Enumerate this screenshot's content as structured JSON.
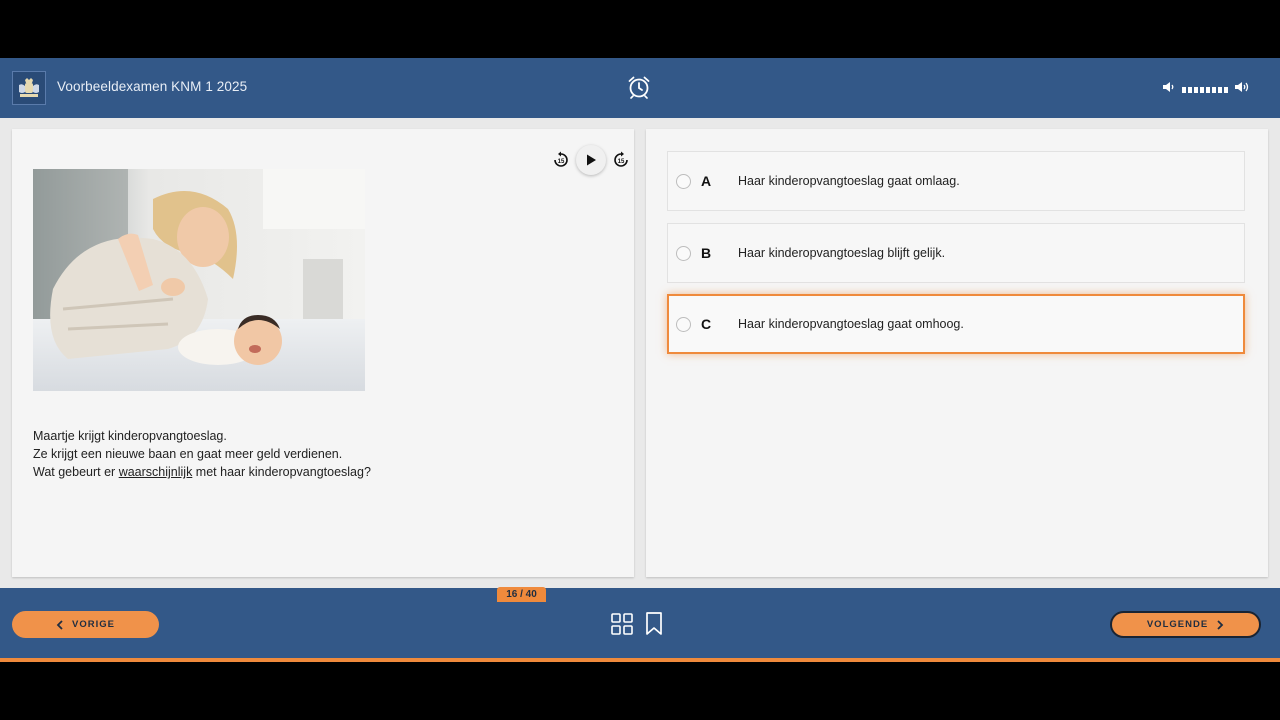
{
  "header": {
    "title": "Voorbeeldexamen KNM 1 2025",
    "logo_icon": "royal-coat-of-arms-icon",
    "timer_icon": "alarm-clock-icon",
    "volume": {
      "mute_icon": "volume-low-icon",
      "loud_icon": "volume-high-icon",
      "level_segments": 8
    }
  },
  "question_panel": {
    "audio": {
      "rewind_icon": "rewind-15-icon",
      "play_icon": "play-icon",
      "forward_icon": "forward-15-icon"
    },
    "image": "mother-playing-with-baby-photo",
    "lines": [
      "Maartje krijgt kinderopvangtoeslag.",
      "Ze krijgt een nieuwe baan en gaat meer geld verdienen."
    ],
    "last_line": {
      "before": "Wat gebeurt er ",
      "underlined": "waarschijnlijk",
      "after": " met haar kinderopvangtoeslag?"
    }
  },
  "answers": [
    {
      "letter": "A",
      "text": "Haar kinderopvangtoeslag gaat omlaag.",
      "selected": false
    },
    {
      "letter": "B",
      "text": "Haar kinderopvangtoeslag blijft gelijk.",
      "selected": false
    },
    {
      "letter": "C",
      "text": "Haar kinderopvangtoeslag gaat omhoog.",
      "selected": true
    }
  ],
  "footer": {
    "prev_label": "VORIGE",
    "next_label": "VOLGENDE",
    "overview_icon": "grid-overview-icon",
    "bookmark_icon": "bookmark-icon",
    "counter": "16 / 40"
  },
  "colors": {
    "brand_blue": "#335888",
    "accent_orange": "#ef8a3c"
  }
}
